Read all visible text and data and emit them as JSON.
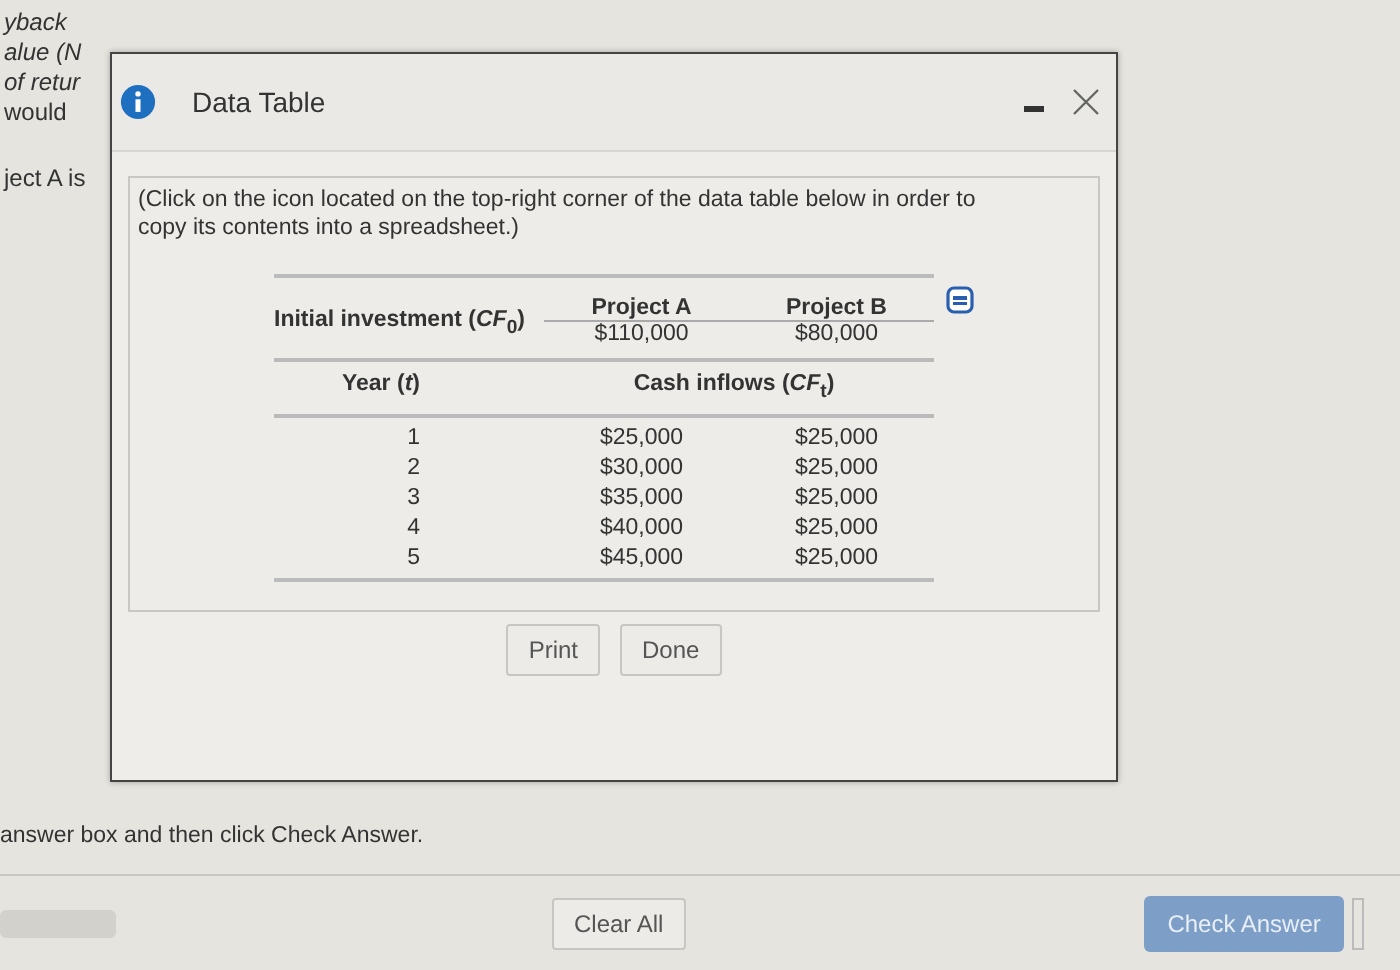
{
  "background_lines": [
    "yback",
    "alue (N",
    "of retur",
    "would",
    "ject A is"
  ],
  "instruction": "answer box and then click Check Answer.",
  "dialog": {
    "title": "Data Table",
    "note": "(Click on the icon located on the top-right corner of the data table below in order to copy its contents into a spreadsheet.)",
    "table": {
      "columns": [
        "Project A",
        "Project B"
      ],
      "initial_label": "Initial investment (*CF*$_{0}$)",
      "initial_values": [
        "$110,000",
        "$80,000"
      ],
      "year_label": "Year (*t*)",
      "inflows_label": "Cash inflows (*CF*$_{t}$)",
      "rows": [
        {
          "year": "1",
          "values": [
            "$25,000",
            "$25,000"
          ]
        },
        {
          "year": "2",
          "values": [
            "$30,000",
            "$25,000"
          ]
        },
        {
          "year": "3",
          "values": [
            "$35,000",
            "$25,000"
          ]
        },
        {
          "year": "4",
          "values": [
            "$40,000",
            "$25,000"
          ]
        },
        {
          "year": "5",
          "values": [
            "$45,000",
            "$25,000"
          ]
        }
      ]
    },
    "buttons": [
      "Print",
      "Done"
    ]
  },
  "footer": {
    "clear": "Clear All",
    "check": "Check Answer"
  }
}
